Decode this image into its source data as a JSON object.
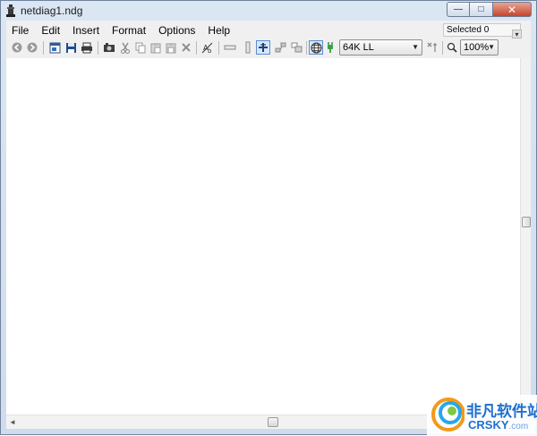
{
  "window": {
    "title": "netdiag1.ndg",
    "caption_buttons": {
      "minimize": "—",
      "maximize": "□",
      "close": "✕"
    }
  },
  "menu": {
    "items": [
      "File",
      "Edit",
      "Insert",
      "Format",
      "Options",
      "Help"
    ]
  },
  "status": {
    "selected": "Selected 0"
  },
  "toolbar": {
    "link_speed": {
      "value": "64K LL"
    },
    "zoom": {
      "value": "100%"
    },
    "icons": [
      "back-icon",
      "forward-icon",
      "new-icon",
      "save-icon",
      "print-icon",
      "properties-icon",
      "cut-icon",
      "copy-icon",
      "paste-icon",
      "paste-special-icon",
      "delete-icon",
      "text-tool-icon",
      "link-tool-icon",
      "vertical-link-icon",
      "connect-tool-icon",
      "group-icon",
      "ungroup-icon",
      "globe-icon",
      "connector-icon",
      "link-type-icon",
      "zoom-icon"
    ]
  },
  "scrollbars": {
    "left_arrow": "◄",
    "right_arrow": "►"
  },
  "watermark": {
    "cn": "非凡软件站",
    "en": "CRSKY",
    "en_suffix": ".com"
  },
  "colors": {
    "titlebar": "#dbe6f3",
    "close": "#c7432a",
    "watermark": "#1e6fd0"
  }
}
